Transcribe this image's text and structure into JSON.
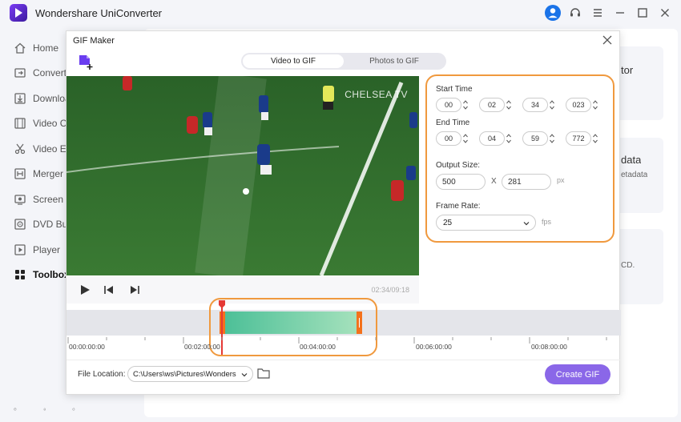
{
  "app": {
    "title": "Wondershare UniConverter"
  },
  "sidebar": {
    "items": [
      {
        "label": "Home"
      },
      {
        "label": "Converter"
      },
      {
        "label": "Downloader"
      },
      {
        "label": "Video Compressor"
      },
      {
        "label": "Video Editor"
      },
      {
        "label": "Merger"
      },
      {
        "label": "Screen Recorder"
      },
      {
        "label": "DVD Burner"
      },
      {
        "label": "Player"
      },
      {
        "label": "Toolbox"
      }
    ]
  },
  "background": {
    "card1_text": "tor",
    "card2_title": "data",
    "card2_sub": "etadata",
    "card3_text": "CD."
  },
  "dialog": {
    "title": "GIF Maker",
    "tabs": [
      {
        "label": "Video to GIF"
      },
      {
        "label": "Photos to GIF"
      }
    ],
    "video": {
      "watermark": "CHELSEA TV",
      "time_readout": "02:34/09:18"
    },
    "settings": {
      "start_label": "Start Time",
      "start": {
        "h": "00",
        "m": "02",
        "s": "34",
        "ms": "023"
      },
      "end_label": "End Time",
      "end": {
        "h": "00",
        "m": "04",
        "s": "59",
        "ms": "772"
      },
      "output_label": "Output Size:",
      "width": "500",
      "sep": "X",
      "height": "281",
      "size_unit": "px",
      "frame_label": "Frame Rate:",
      "frame_rate": "25",
      "frame_unit": "fps"
    },
    "timeline": {
      "ticks": [
        "00:00:00:00",
        "00:02:00:00",
        "00:04:00:00",
        "00:06:00:00",
        "00:08:00:00"
      ]
    },
    "file_location": {
      "label": "File Location:",
      "path": "C:\\Users\\ws\\Pictures\\Wonders"
    },
    "create_label": "Create GIF"
  }
}
